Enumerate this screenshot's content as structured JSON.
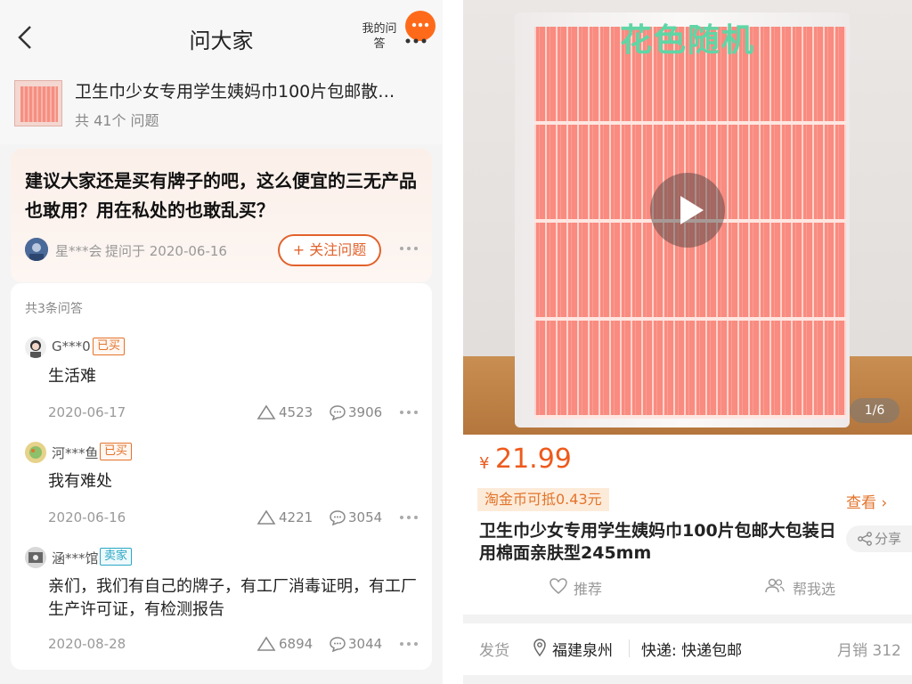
{
  "qa_page": {
    "title": "问大家",
    "my_answers_label": "我的问答",
    "product": {
      "title": "卫生巾少女专用学生姨妈巾100片包邮散…",
      "question_count": "共 41个 问题"
    },
    "question": {
      "text": "建议大家还是买有牌子的吧，这么便宜的三无产品也敢用？用在私处的也敢乱买？",
      "asker": "星***会",
      "asked_at": "提问于 2020-06-16",
      "follow_label": "+ 关注问题"
    },
    "answers_count": "共3条问答",
    "answers": [
      {
        "user": "G***0",
        "badge": "已买",
        "badge_type": "bought",
        "text": "生活难",
        "date": "2020-06-17",
        "likes": "4523",
        "comments": "3906"
      },
      {
        "user": "河***鱼",
        "badge": "已买",
        "badge_type": "bought",
        "text": "我有难处",
        "date": "2020-06-16",
        "likes": "4221",
        "comments": "3054"
      },
      {
        "user": "涵***馆",
        "badge": "卖家",
        "badge_type": "seller",
        "text": "亲们，我们有自己的牌子，有工厂消毒证明，有工厂生产许可证，有检测报告",
        "date": "2020-08-28",
        "likes": "6894",
        "comments": "3044"
      }
    ]
  },
  "product_page": {
    "photo_caption": "花色随机",
    "page_indicator": "1/6",
    "price_symbol": "¥",
    "price": "21.99",
    "coin_offset": "淘金币可抵0.43元",
    "view_label": "查看 ›",
    "title": "卫生巾少女专用学生姨妈巾100片包邮大包装日用棉面亲肤型245mm",
    "share_label": "分享",
    "recommend_label": "推荐",
    "help_choose_label": "帮我选",
    "ship_label": "发货",
    "ship_from": "福建泉州",
    "express": "快递: 快递包邮",
    "monthly_sales": "月销 312"
  },
  "colors": {
    "accent_orange": "#e2622c",
    "price_red": "#ee5a1c",
    "seller_blue": "#2aa7c4",
    "caption_green": "#5fd6a6"
  },
  "icons": [
    "back-arrow-icon",
    "more-icon",
    "play-icon",
    "like-triangle-icon",
    "comment-icon",
    "share-icon",
    "heart-icon",
    "people-icon",
    "location-pin-icon"
  ]
}
